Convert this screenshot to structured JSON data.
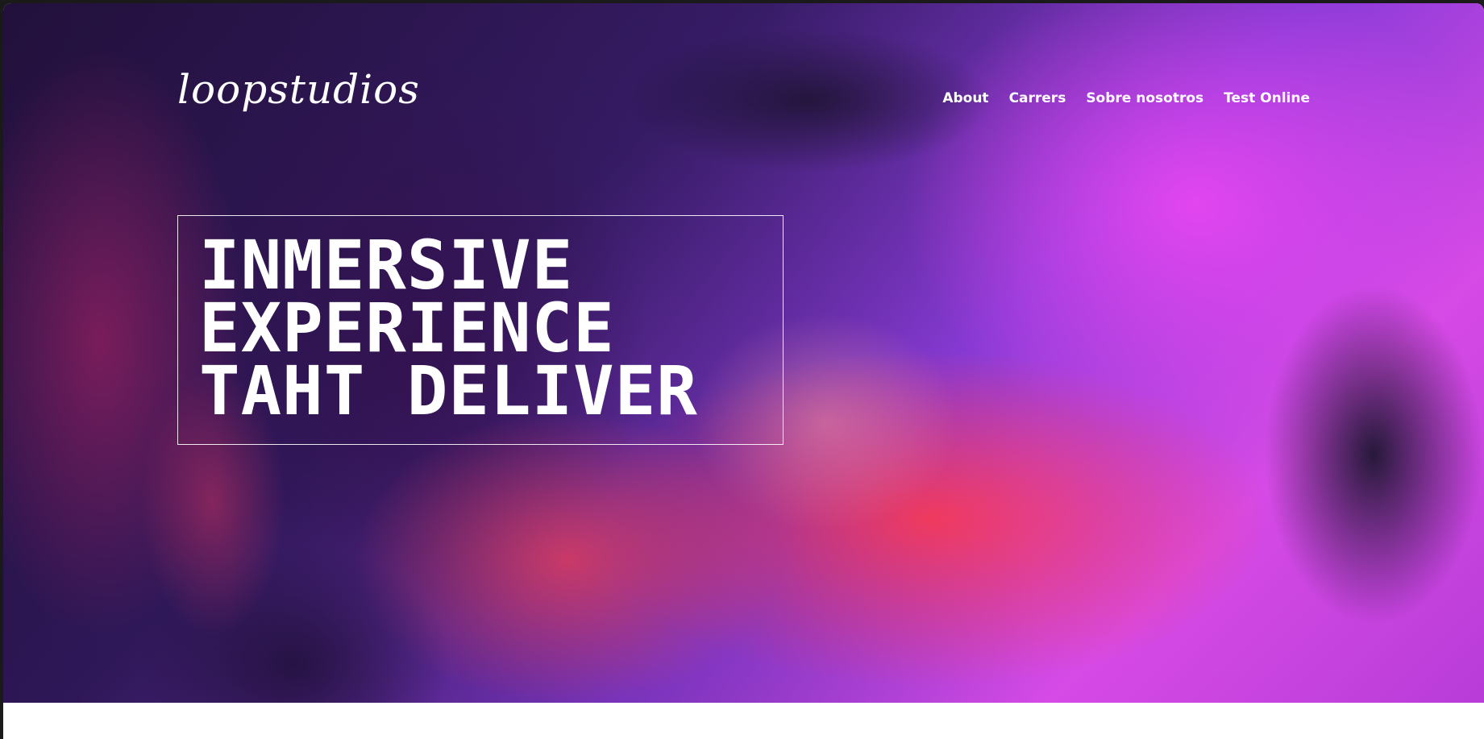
{
  "header": {
    "logo": "loopstudios",
    "nav": [
      {
        "label": "About"
      },
      {
        "label": "Carrers"
      },
      {
        "label": "Sobre nosotros"
      },
      {
        "label": "Test Online"
      }
    ]
  },
  "hero": {
    "headline": [
      "INMERSIVE",
      "EXPERIENCE",
      "TAHT DELIVER"
    ],
    "image": "vr-headset-gaming-photo"
  }
}
